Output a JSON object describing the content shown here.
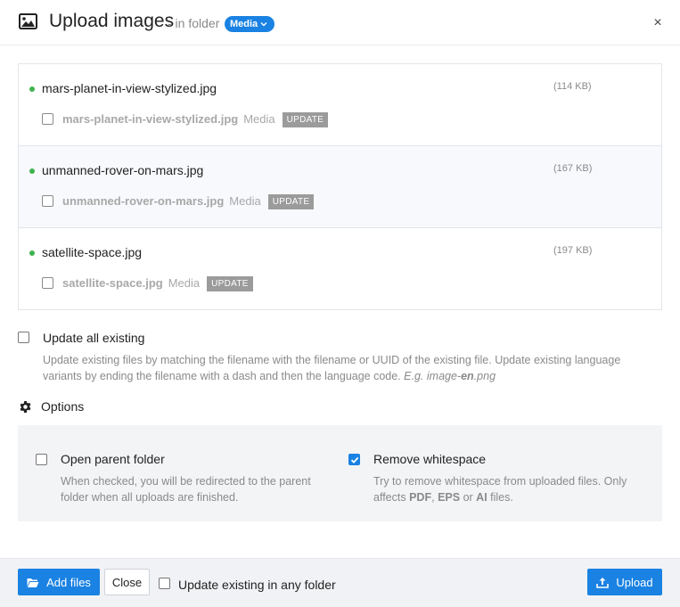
{
  "header": {
    "title": "Upload images",
    "in_folder": "- in folder",
    "folder_badge": "Media",
    "close": "×"
  },
  "files": [
    {
      "name": "mars-planet-in-view-stylized.jpg",
      "size": "(114 KB)",
      "existing_name": "mars-planet-in-view-stylized.jpg",
      "existing_folder": "Media",
      "update_label": "UPDATE"
    },
    {
      "name": "unmanned-rover-on-mars.jpg",
      "size": "(167 KB)",
      "existing_name": "unmanned-rover-on-mars.jpg",
      "existing_folder": "Media",
      "update_label": "UPDATE"
    },
    {
      "name": "satellite-space.jpg",
      "size": "(197 KB)",
      "existing_name": "satellite-space.jpg",
      "existing_folder": "Media",
      "update_label": "UPDATE"
    }
  ],
  "update_all": {
    "label": "Update all existing",
    "help_line1": "Update existing files by matching the filename with the filename or UUID of the existing file. Update existing language",
    "help_line2": "variants by ending the filename with a dash and then the language code.",
    "help_eg": "E.g. image-",
    "help_eg_bold": "en",
    "help_eg_ext": ".png",
    "checked": false
  },
  "options": {
    "title": "Options",
    "open_parent": {
      "label": "Open parent folder",
      "help_line1": "When checked, you will be redirected to the parent",
      "help_line2": "folder when all uploads are finished.",
      "checked": false
    },
    "remove_whitespace": {
      "label": "Remove whitespace",
      "help_line1": "Try to remove whitespace from uploaded files. Only",
      "help_line2_a": "affects",
      "help_pdf": "PDF",
      "help_sep1": ",",
      "help_eps": "EPS",
      "help_or": "or",
      "help_ai": "AI",
      "help_end": "files.",
      "checked": true
    }
  },
  "footer": {
    "add_files": "Add files",
    "close": "Close",
    "update_any_folder": "Update existing in any folder",
    "upload": "Upload"
  },
  "colors": {
    "primary": "#1a82e2",
    "success_dot": "#3fb34f",
    "update_badge": "#9b9b9b"
  }
}
